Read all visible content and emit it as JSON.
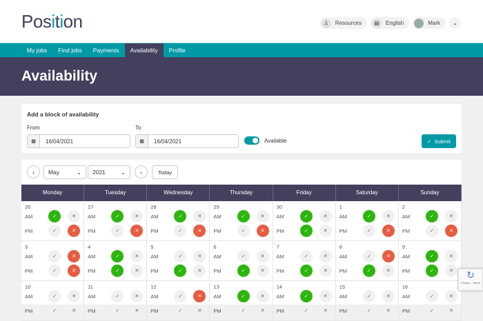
{
  "header": {
    "logo": "Position",
    "resources": "Resources",
    "language": "English",
    "user": "Mark"
  },
  "nav": [
    {
      "label": "My jobs"
    },
    {
      "label": "Find jobs"
    },
    {
      "label": "Payments"
    },
    {
      "label": "Availability",
      "active": true
    },
    {
      "label": "Profile"
    }
  ],
  "page_title": "Availability",
  "form": {
    "title": "Add a block of availability",
    "from_label": "From",
    "from_value": "16/04/2021",
    "to_label": "To",
    "to_value": "16/04/2021",
    "toggle_label": "Available",
    "toggle_on": true,
    "submit": "Submit"
  },
  "calendar": {
    "month": "May",
    "year": "2021",
    "today": "Today",
    "days": [
      "Monday",
      "Tuesday",
      "Wednesday",
      "Thursday",
      "Friday",
      "Saturday",
      "Sunday"
    ],
    "am": "AM",
    "pm": "PM",
    "weeks": [
      [
        {
          "d": "26",
          "am": "yes",
          "pm": "no"
        },
        {
          "d": "27",
          "am": "yes",
          "pm": "no"
        },
        {
          "d": "28",
          "am": "yes",
          "pm": "no"
        },
        {
          "d": "29",
          "am": "yes",
          "pm": "no"
        },
        {
          "d": "30",
          "am": "yes",
          "pm": "yes"
        },
        {
          "d": "1",
          "am": "yes",
          "pm": "no"
        },
        {
          "d": "2",
          "am": "yes",
          "pm": "no"
        }
      ],
      [
        {
          "d": "3",
          "am": "no",
          "pm": "no"
        },
        {
          "d": "4",
          "am": "yes",
          "pm": "yes"
        },
        {
          "d": "5",
          "am": "none",
          "pm": "yes"
        },
        {
          "d": "6",
          "am": "none",
          "pm": "yes"
        },
        {
          "d": "7",
          "am": "none",
          "pm": "yes"
        },
        {
          "d": "8",
          "am": "no",
          "pm": "yes"
        },
        {
          "d": "9",
          "am": "yes",
          "pm": "yes"
        }
      ],
      [
        {
          "d": "10",
          "am": "none",
          "pm": "none"
        },
        {
          "d": "11",
          "am": "none",
          "pm": "none"
        },
        {
          "d": "12",
          "am": "no",
          "pm": "none"
        },
        {
          "d": "13",
          "am": "yes",
          "pm": "none"
        },
        {
          "d": "14",
          "am": "yes",
          "pm": "none"
        },
        {
          "d": "15",
          "am": "none",
          "pm": "none"
        },
        {
          "d": "16",
          "am": "none",
          "pm": "none"
        }
      ]
    ]
  },
  "recaptcha": "Privacy - Terms",
  "colors": {
    "teal": "#009aa6",
    "navy": "#42405c",
    "available": "#2db60e",
    "unavailable": "#e85c41"
  }
}
